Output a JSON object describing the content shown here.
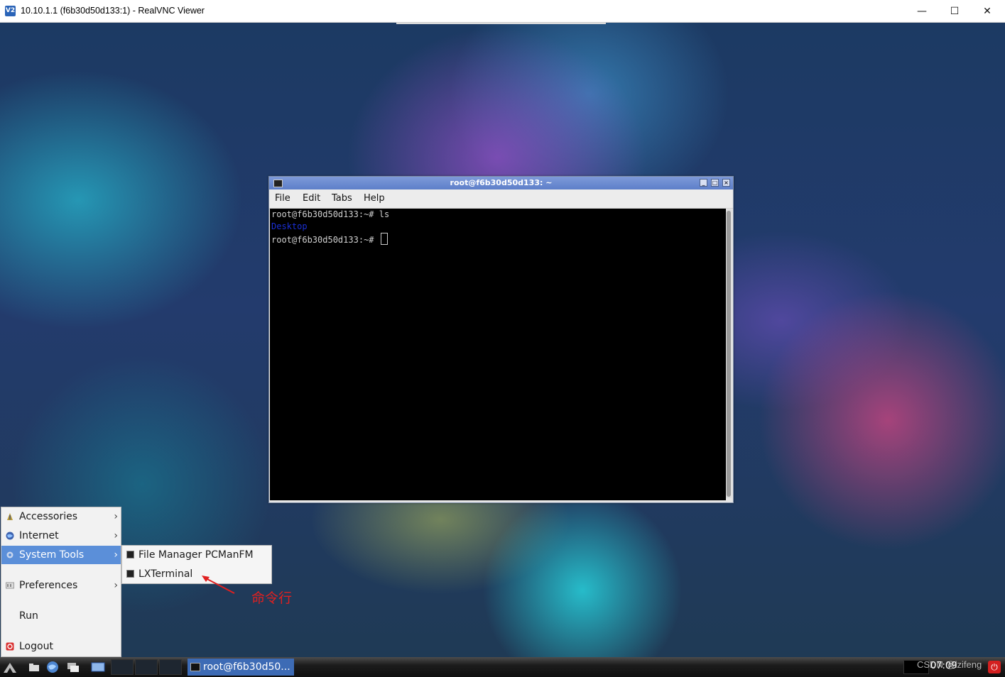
{
  "host": {
    "title": "10.10.1.1 (f6b30d50d133:1) - RealVNC Viewer",
    "controls": {
      "minimize": "—",
      "maximize": "☐",
      "close": "✕"
    }
  },
  "terminal": {
    "title": "root@f6b30d50d133: ~",
    "menu": [
      "File",
      "Edit",
      "Tabs",
      "Help"
    ],
    "lines": [
      {
        "prompt": "root@f6b30d50d133:~# ",
        "cmd": "ls"
      },
      {
        "output": "Desktop"
      },
      {
        "prompt": "root@f6b30d50d133:~# ",
        "cmd": ""
      }
    ]
  },
  "start_menu": {
    "items": [
      {
        "label": "Accessories",
        "icon": "accessories-icon",
        "has_submenu": true
      },
      {
        "label": "Internet",
        "icon": "globe-icon",
        "has_submenu": true
      },
      {
        "label": "System Tools",
        "icon": "gear-icon",
        "has_submenu": true,
        "active": true
      },
      {
        "label": "Preferences",
        "icon": "preferences-icon",
        "has_submenu": true
      },
      {
        "label": "Run",
        "icon": "",
        "has_submenu": false
      },
      {
        "label": "Logout",
        "icon": "logout-icon",
        "has_submenu": false
      }
    ],
    "chevron": "›"
  },
  "submenu": {
    "items": [
      {
        "label": "File Manager PCManFM",
        "icon": "file-manager-icon"
      },
      {
        "label": "LXTerminal",
        "icon": "terminal-icon"
      }
    ]
  },
  "annotation": {
    "text": "命令行",
    "color": "#e02020"
  },
  "taskbar": {
    "task_label": "root@f6b30d50...",
    "clock": "07:09",
    "watermark": "CSDN @lzifeng"
  },
  "colors": {
    "menu_highlight": "#5b8fd9",
    "taskbar_active": "#3d6bb5",
    "terminal_bg": "#000000",
    "dir_color": "#1a2fd6"
  }
}
